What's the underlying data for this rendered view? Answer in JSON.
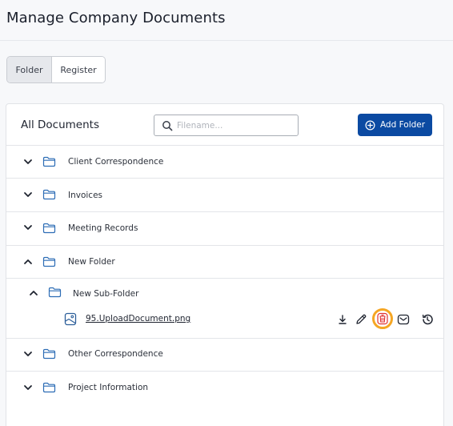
{
  "header": {
    "title": "Manage Company Documents"
  },
  "tabs": {
    "folder": "Folder",
    "register": "Register"
  },
  "panel": {
    "title": "All Documents",
    "search_placeholder": "Filename...",
    "add_folder_label": "Add Folder"
  },
  "folders": [
    {
      "label": "Client Correspondence",
      "expanded": false
    },
    {
      "label": "Invoices",
      "expanded": false
    },
    {
      "label": "Meeting Records",
      "expanded": false
    },
    {
      "label": "New Folder",
      "expanded": true
    },
    {
      "label": "New Sub-Folder",
      "expanded": true
    },
    {
      "label": "Other Correspondence",
      "expanded": false
    },
    {
      "label": "Project Information",
      "expanded": false
    }
  ],
  "file": {
    "name": "95.UploadDocument.png",
    "actions": [
      "download-icon",
      "edit-icon",
      "delete-icon",
      "email-icon",
      "history-icon"
    ]
  },
  "colors": {
    "primary": "#0b4aa2",
    "delete": "#e03131",
    "highlight": "#f5a623",
    "folder_icon": "#2d6db5"
  }
}
